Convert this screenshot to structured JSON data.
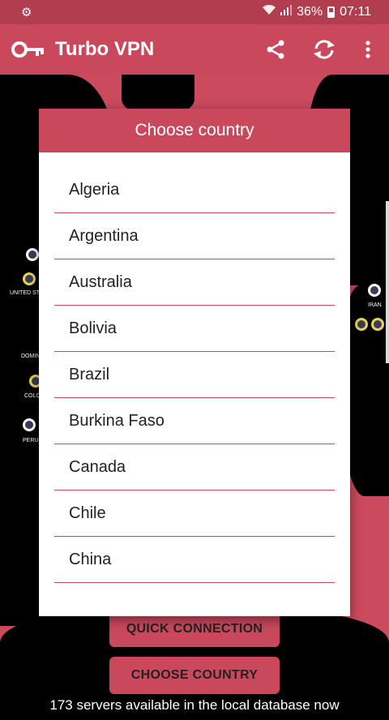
{
  "status_bar": {
    "battery": "36%",
    "time": "07:11"
  },
  "app_bar": {
    "title": "Turbo VPN"
  },
  "map_labels": [
    "UNITED STA",
    "DOMIN",
    "COLO",
    "PERU",
    "IRAN"
  ],
  "dialog": {
    "title": "Choose country",
    "countries": [
      "Algeria",
      "Argentina",
      "Australia",
      "Bolivia",
      "Brazil",
      "Burkina Faso",
      "Canada",
      "Chile",
      "China"
    ]
  },
  "buttons": {
    "quick_connection": "QUICK CONNECTION",
    "choose_country": "CHOOSE COUNTRY"
  },
  "footer": {
    "text": "173 servers available in the local database now"
  },
  "colors": {
    "primary": "#c9485c",
    "status_bar": "#b23d4f",
    "map_land": "#000000"
  }
}
